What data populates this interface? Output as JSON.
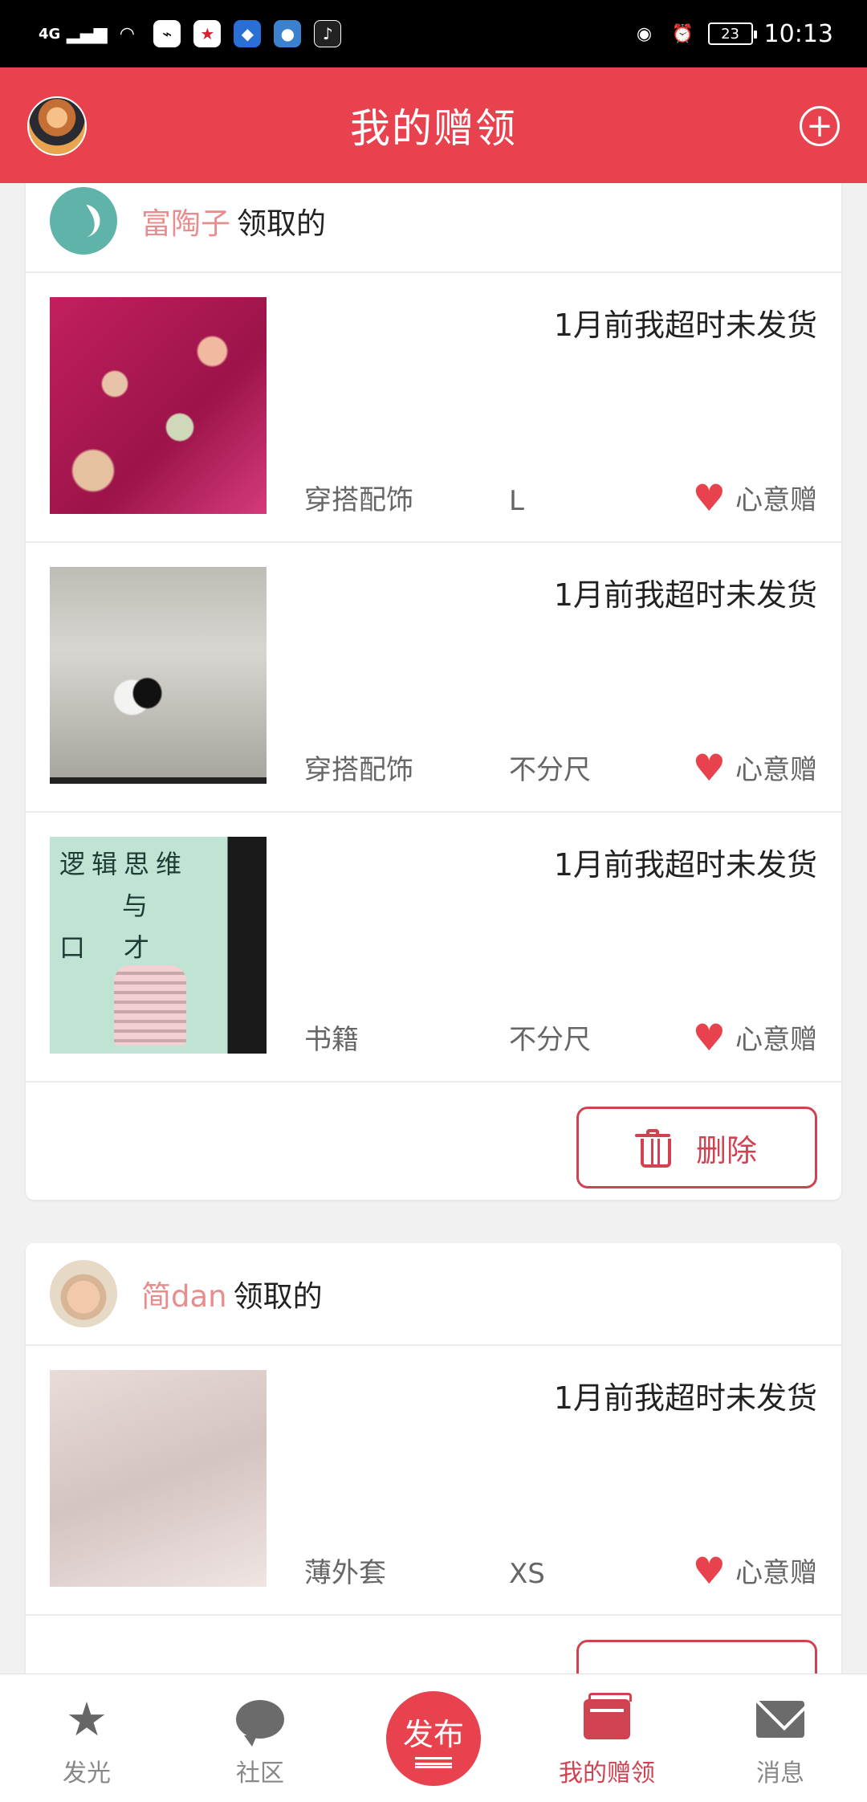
{
  "status_bar": {
    "network": "4G",
    "time": "10:13",
    "battery": "23"
  },
  "header": {
    "title": "我的赠领"
  },
  "cards": [
    {
      "user_name": "富陶子",
      "user_action": "领取的",
      "items": [
        {
          "status": "1月前我超时未发货",
          "category": "穿搭配饰",
          "size": "L",
          "tag": "心意赠"
        },
        {
          "status": "1月前我超时未发货",
          "category": "穿搭配饰",
          "size": "不分尺",
          "tag": "心意赠"
        },
        {
          "status": "1月前我超时未发货",
          "category": "书籍",
          "size": "不分尺",
          "tag": "心意赠",
          "thumb_text": [
            "逻辑思维",
            "与",
            "口　才"
          ]
        }
      ],
      "delete_label": "删除"
    },
    {
      "user_name": "简dan",
      "user_action": "领取的",
      "items": [
        {
          "status": "1月前我超时未发货",
          "category": "薄外套",
          "size": "XS",
          "tag": "心意赠"
        }
      ]
    }
  ],
  "bottom_nav": {
    "items": [
      {
        "label": "发光",
        "icon": "star-icon"
      },
      {
        "label": "社区",
        "icon": "chat-bubble-icon"
      },
      {
        "label": "发布",
        "icon": "publish-icon"
      },
      {
        "label": "我的赠领",
        "icon": "gift-cards-icon",
        "active": true
      },
      {
        "label": "消息",
        "icon": "mail-icon"
      }
    ]
  },
  "colors": {
    "brand": "#e8424f",
    "username": "#e88d8d",
    "delete": "#d0424f"
  }
}
